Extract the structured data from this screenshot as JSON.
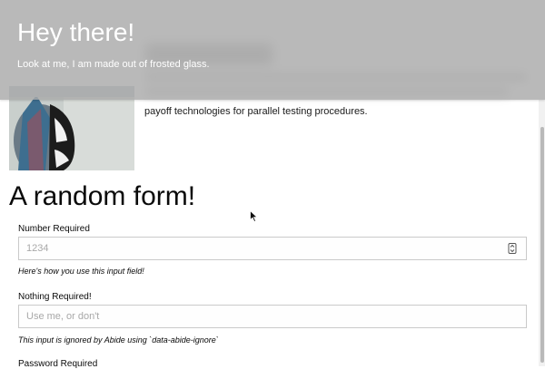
{
  "header": {
    "title": "Hey there!",
    "subtitle": "Look at me, I am made out of frosted glass."
  },
  "media": {
    "text": "payoff technologies for parallel testing procedures."
  },
  "form": {
    "title": "A random form!",
    "number_label": "Number Required",
    "number_placeholder": "1234",
    "number_help": "Here's how you use this input field!",
    "nothing_label": "Nothing Required!",
    "nothing_placeholder": "Use me, or don't",
    "nothing_help": "This input is ignored by Abide using `data-abide-ignore`",
    "password_label": "Password Required"
  },
  "icons": {
    "number_spinner": "stepper-icon",
    "cursor": "mouse-pointer-icon"
  },
  "colors": {
    "glass": "#aaaaaa",
    "glass_text": "#ffffff",
    "input_border": "#cacaca",
    "placeholder": "#a8a8a8"
  }
}
